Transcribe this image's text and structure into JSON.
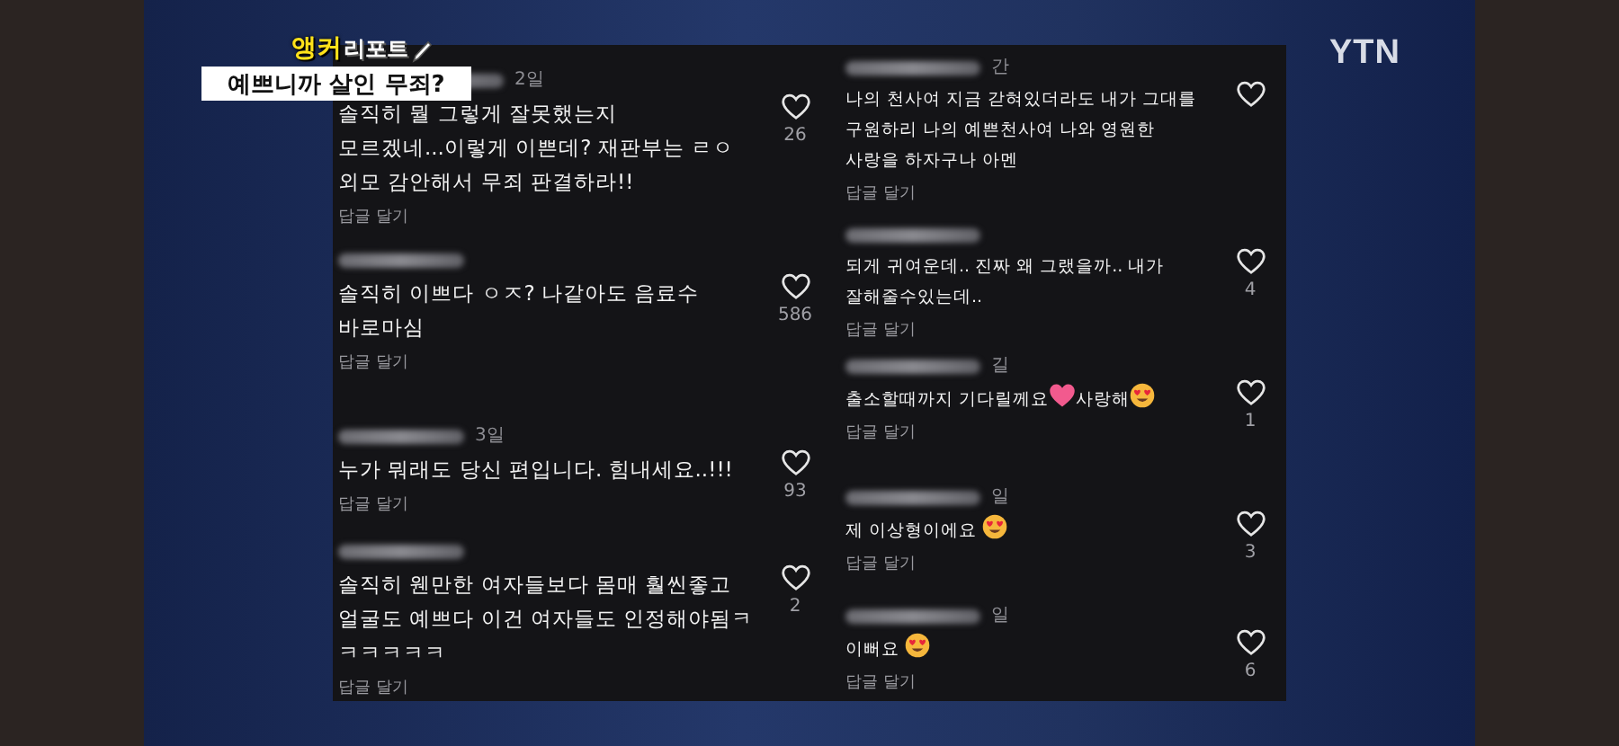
{
  "broadcaster": {
    "logo": "YTN"
  },
  "caption": {
    "tag_strong": "앵커",
    "tag": "리포트",
    "headline": "예쁘니까 살인 무죄?"
  },
  "panels": [
    {
      "comments": [
        {
          "time": "2일",
          "parts": [
            {
              "kind": "text",
              "text": "솔직히 뭘 그렇게 잘못했는지\n모르겠네...이렇게 이쁜데? 재판부는 ㄹㅇ\n외모 감안해서 무죄 판결하라!!"
            }
          ],
          "likes": "26",
          "reply": "답글 달기"
        },
        {
          "parts": [
            {
              "kind": "text",
              "text": "솔직히 이쁘다 ㅇㅈ? 나같아도 음료수\n바로마심"
            }
          ],
          "likes": "586",
          "reply": "답글 달기"
        },
        {
          "time": "3일",
          "parts": [
            {
              "kind": "text",
              "text": "누가 뭐래도 당신 편입니다. 힘내세요..!!!"
            }
          ],
          "likes": "93",
          "reply": "답글 달기"
        },
        {
          "parts": [
            {
              "kind": "text",
              "text": "솔직히 웬만한 여자들보다 몸매 훨씬좋고\n얼굴도 예쁘다 이건 여자들도 인정해야됨ㅋㅋㅋㅋㅋㅋ"
            }
          ],
          "likes": "2",
          "reply": "답글 달기"
        }
      ]
    },
    {
      "comments": [
        {
          "time": "간",
          "parts": [
            {
              "kind": "text",
              "text": "나의 천사여 지금 갇혀있더라도 내가 그대를\n구원하리 나의 예쁜천사여 나와 영원한\n사랑을 하자구나 아멘"
            }
          ],
          "reply": "답글 달기"
        },
        {
          "parts": [
            {
              "kind": "text",
              "text": "되게 귀여운데.. 진짜 왜 그랬을까.. 내가\n잘해줄수있는데.."
            }
          ],
          "likes": "4",
          "reply": "답글 달기"
        },
        {
          "time": "길",
          "parts": [
            {
              "kind": "text",
              "text": "출소할때까지 기다릴께요"
            },
            {
              "kind": "heart"
            },
            {
              "kind": "text",
              "text": "사랑해"
            },
            {
              "kind": "heart-eyes"
            }
          ],
          "likes": "1",
          "reply": "답글 달기"
        },
        {
          "time": "일",
          "parts": [
            {
              "kind": "text",
              "text": "제 이상형이에요 "
            },
            {
              "kind": "heart-eyes"
            }
          ],
          "likes": "3",
          "reply": "답글 달기"
        },
        {
          "time": "일",
          "parts": [
            {
              "kind": "text",
              "text": "이뻐요 "
            },
            {
              "kind": "heart-eyes"
            }
          ],
          "likes": "6",
          "reply": "답글 달기"
        }
      ]
    }
  ]
}
